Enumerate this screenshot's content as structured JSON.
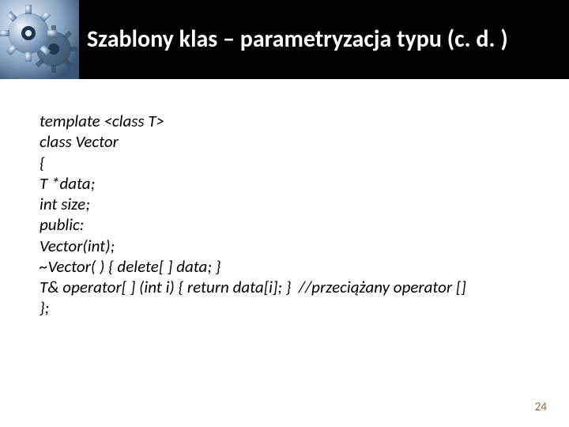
{
  "header": {
    "title": "Szablony klas – parametryzacja typu (c. d. )"
  },
  "code": {
    "lines": [
      "template <class T>",
      "class Vector",
      "{",
      "T *data;",
      "int size;",
      "public:",
      "Vector(int);",
      "~Vector( ) { delete[ ] data; }",
      "T& operator[ ] (int i) { return data[i]; }  //przeciążany operator []",
      "};"
    ]
  },
  "footer": {
    "page_number": "24"
  }
}
